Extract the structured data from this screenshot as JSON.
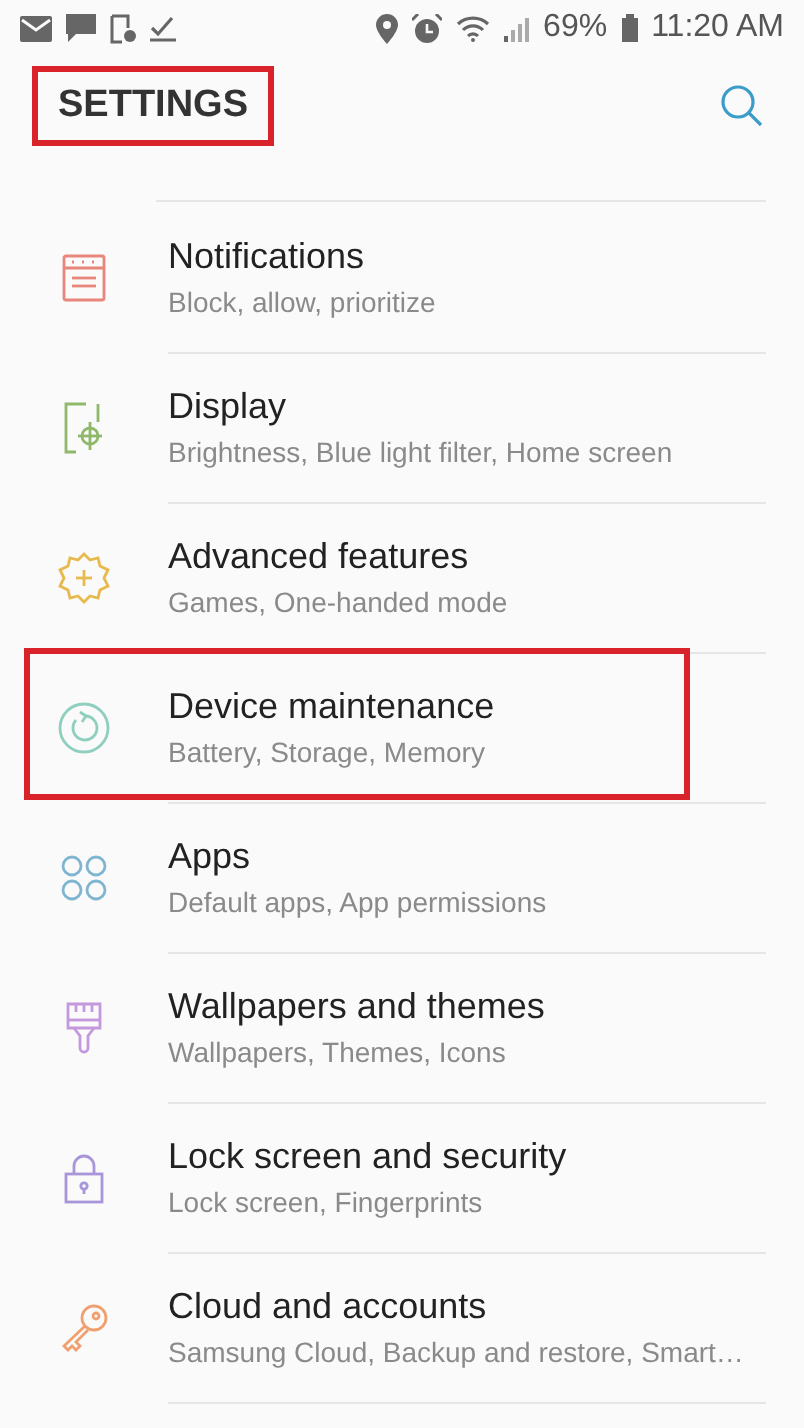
{
  "status_bar": {
    "battery": "69%",
    "time": "11:20 AM"
  },
  "header": {
    "title": "SETTINGS",
    "highlighted": true
  },
  "items": [
    {
      "title": "Notifications",
      "subtitle": "Block, allow, prioritize",
      "color": "#e8867c",
      "highlighted": false
    },
    {
      "title": "Display",
      "subtitle": "Brightness, Blue light filter, Home screen",
      "color": "#8fb86a",
      "highlighted": false
    },
    {
      "title": "Advanced features",
      "subtitle": "Games, One-handed mode",
      "color": "#e8b94c",
      "highlighted": false
    },
    {
      "title": "Device maintenance",
      "subtitle": "Battery, Storage, Memory",
      "color": "#8fcfc0",
      "highlighted": true
    },
    {
      "title": "Apps",
      "subtitle": "Default apps, App permissions",
      "color": "#7fb5d0",
      "highlighted": false
    },
    {
      "title": "Wallpapers and themes",
      "subtitle": "Wallpapers, Themes, Icons",
      "color": "#c498dc",
      "highlighted": false
    },
    {
      "title": "Lock screen and security",
      "subtitle": "Lock screen, Fingerprints",
      "color": "#a896d8",
      "highlighted": false
    },
    {
      "title": "Cloud and accounts",
      "subtitle": "Samsung Cloud, Backup and restore, Smart…",
      "color": "#f0a070",
      "highlighted": false
    }
  ]
}
